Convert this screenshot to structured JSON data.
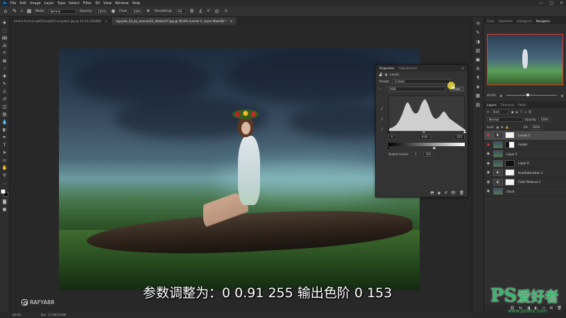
{
  "app": {
    "logo": "Ps"
  },
  "menu": [
    "File",
    "Edit",
    "Image",
    "Layer",
    "Type",
    "Select",
    "Filter",
    "3D",
    "View",
    "Window",
    "Help"
  ],
  "window_controls": [
    "—",
    "□",
    "✕"
  ],
  "options_bar": {
    "brush_size": "2",
    "mode_label": "Mode:",
    "mode_value": "Normal",
    "opacity_label": "Opacity:",
    "opacity_value": "100%",
    "flow_label": "Flow:",
    "flow_value": "100%",
    "smoothing_label": "Smoothing:",
    "smoothing_value": "0%",
    "angle_value": "0°"
  },
  "tabs": [
    {
      "label": "emma-francis-vpHCfunwDrQ-unsplash.jpg @ 33.3% (RGB/8)",
      "close": "×"
    },
    {
      "label": "layyalie_03_by_ananda23_d6sbm47.jpg @ 40.6% (Levels 1, Layer Mask/8) *",
      "close": "×"
    }
  ],
  "status_bar": {
    "zoom": "40.6%",
    "doc": "Doc: 17.0M/76.8M"
  },
  "overlay": {
    "handle": "RAFYA88",
    "subtitle": "参数调整为：0 0.91 255  输出色阶 0 153"
  },
  "properties": {
    "tabs": [
      "Properties",
      "Adjustments"
    ],
    "title": "Levels",
    "preset_label": "Preset:",
    "preset_value": "Custom",
    "channel": "RGB",
    "auto_label": "Auto",
    "input_black": "0",
    "input_gamma": "0.91",
    "input_white": "255",
    "output_label": "Output Levels:",
    "output_black": "0",
    "output_white": "153"
  },
  "histogram": {
    "bins": [
      2,
      3,
      3,
      4,
      5,
      6,
      8,
      10,
      13,
      16,
      20,
      24,
      27,
      28,
      26,
      23,
      20,
      18,
      17,
      17,
      18,
      21,
      25,
      28,
      30,
      31,
      29,
      26,
      22,
      18,
      15,
      13,
      12,
      12,
      13,
      14,
      16,
      18,
      19,
      18,
      16,
      14,
      12,
      11,
      10,
      9,
      8,
      7,
      6,
      5,
      4,
      3,
      2,
      1
    ],
    "input_levels": [
      0,
      0.91,
      255
    ],
    "output_levels": [
      0,
      153
    ]
  },
  "right_panel": {
    "top_tabs": [
      "Color",
      "Swatches",
      "Histogram",
      "Navigator"
    ],
    "nav_zoom": "40.6%",
    "layers_tabs": [
      "Layers",
      "Channels",
      "Paths"
    ],
    "kind_label": "Kind",
    "blend_mode": "Normal",
    "opacity_label": "Opacity:",
    "opacity_value": "100%",
    "lock_label": "Lock:",
    "fill_label": "Fill:",
    "fill_value": "100%",
    "layers": [
      {
        "name": "Levels 1",
        "thumb": "adj",
        "mask": "white",
        "selected": true,
        "eye_red": true
      },
      {
        "name": "model",
        "thumb": "photo",
        "mask": "mix",
        "selected": false,
        "eye_red": true
      },
      {
        "name": "Layer 2",
        "thumb": "photo",
        "mask": "",
        "selected": false,
        "eye_red": false
      },
      {
        "name": "Layer 0",
        "thumb": "photo",
        "mask": "black",
        "selected": false,
        "eye_red": false
      },
      {
        "name": "Hue/Saturation 1",
        "thumb": "adj",
        "mask": "white",
        "selected": false,
        "eye_red": false
      },
      {
        "name": "Color Balance 1",
        "thumb": "adj",
        "mask": "white",
        "selected": false,
        "eye_red": false
      },
      {
        "name": "cloud",
        "thumb": "photo",
        "mask": "",
        "selected": false,
        "eye_red": false
      }
    ]
  },
  "site_watermark": {
    "brand": "PS",
    "han": "爱好者",
    "url": "www.psahz.com"
  }
}
